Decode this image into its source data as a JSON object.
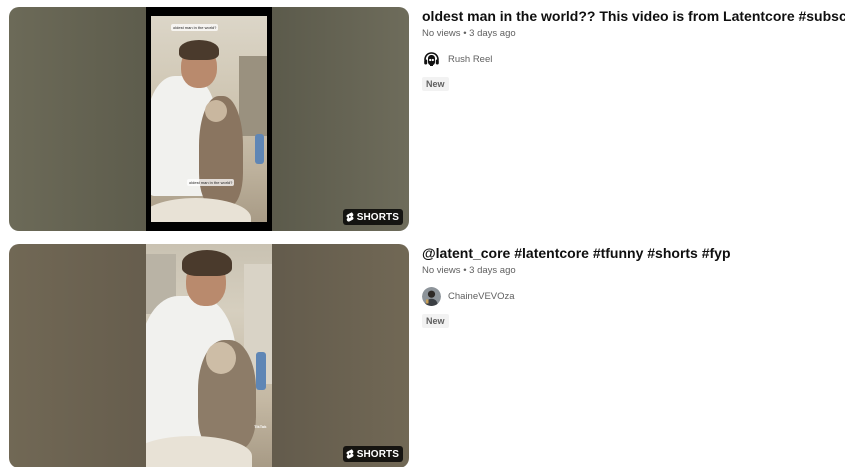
{
  "results": [
    {
      "title": "oldest man in the world?? This video is from Latentcore #subscribe",
      "views": "No views",
      "age": "3 days ago",
      "channel": "Rush Reel",
      "badge": "New",
      "overlay_label": "SHORTS",
      "thumb_caption_top": "oldest man in the world?",
      "thumb_caption_bottom": "oldest man in the world?",
      "avatar_icon": "headphones-skull-icon"
    },
    {
      "title": "@latent_core #latentcore #tfunny #shorts #fyp",
      "views": "No views",
      "age": "3 days ago",
      "channel": "ChaineVEVOza",
      "badge": "New",
      "overlay_label": "SHORTS",
      "thumb_watermark": "TikTok",
      "avatar_icon": "person-avatar-icon"
    }
  ],
  "meta_separator": "•",
  "colors": {
    "title": "#0f0f0f",
    "secondary": "#606060",
    "badge_bg": "#f2f2f2",
    "overlay_bg": "#000000"
  }
}
